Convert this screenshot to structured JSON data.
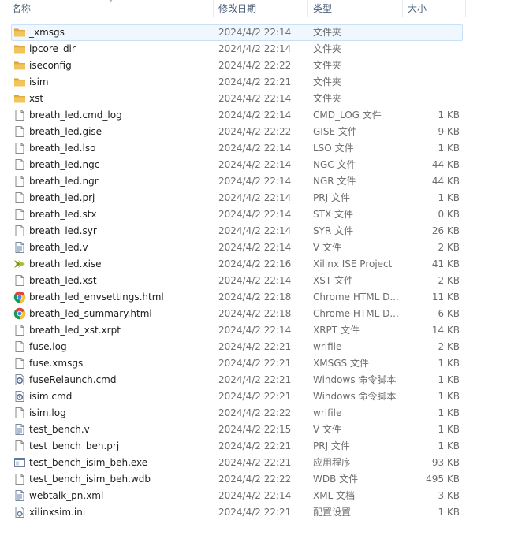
{
  "header": {
    "name": "名称",
    "date": "修改日期",
    "type": "类型",
    "size": "大小"
  },
  "files": [
    {
      "name": "_xmsgs",
      "date": "2024/4/2 22:14",
      "type": "文件夹",
      "size": "",
      "icon": "folder-icon",
      "selected": true
    },
    {
      "name": "ipcore_dir",
      "date": "2024/4/2 22:14",
      "type": "文件夹",
      "size": "",
      "icon": "folder-icon"
    },
    {
      "name": "iseconfig",
      "date": "2024/4/2 22:22",
      "type": "文件夹",
      "size": "",
      "icon": "folder-icon"
    },
    {
      "name": "isim",
      "date": "2024/4/2 22:21",
      "type": "文件夹",
      "size": "",
      "icon": "folder-icon"
    },
    {
      "name": "xst",
      "date": "2024/4/2 22:14",
      "type": "文件夹",
      "size": "",
      "icon": "folder-icon"
    },
    {
      "name": "breath_led.cmd_log",
      "date": "2024/4/2 22:14",
      "type": "CMD_LOG 文件",
      "size": "1 KB",
      "icon": "file-icon"
    },
    {
      "name": "breath_led.gise",
      "date": "2024/4/2 22:22",
      "type": "GISE 文件",
      "size": "9 KB",
      "icon": "file-icon"
    },
    {
      "name": "breath_led.lso",
      "date": "2024/4/2 22:14",
      "type": "LSO 文件",
      "size": "1 KB",
      "icon": "file-icon"
    },
    {
      "name": "breath_led.ngc",
      "date": "2024/4/2 22:14",
      "type": "NGC 文件",
      "size": "44 KB",
      "icon": "file-icon"
    },
    {
      "name": "breath_led.ngr",
      "date": "2024/4/2 22:14",
      "type": "NGR 文件",
      "size": "44 KB",
      "icon": "file-icon"
    },
    {
      "name": "breath_led.prj",
      "date": "2024/4/2 22:14",
      "type": "PRJ 文件",
      "size": "1 KB",
      "icon": "file-icon"
    },
    {
      "name": "breath_led.stx",
      "date": "2024/4/2 22:14",
      "type": "STX 文件",
      "size": "0 KB",
      "icon": "file-icon"
    },
    {
      "name": "breath_led.syr",
      "date": "2024/4/2 22:14",
      "type": "SYR 文件",
      "size": "26 KB",
      "icon": "file-icon"
    },
    {
      "name": "breath_led.v",
      "date": "2024/4/2 22:14",
      "type": "V 文件",
      "size": "2 KB",
      "icon": "text-file-icon"
    },
    {
      "name": "breath_led.xise",
      "date": "2024/4/2 22:16",
      "type": "Xilinx ISE Project",
      "size": "41 KB",
      "icon": "xilinx-icon"
    },
    {
      "name": "breath_led.xst",
      "date": "2024/4/2 22:14",
      "type": "XST 文件",
      "size": "2 KB",
      "icon": "file-icon"
    },
    {
      "name": "breath_led_envsettings.html",
      "date": "2024/4/2 22:18",
      "type": "Chrome HTML D...",
      "size": "11 KB",
      "icon": "chrome-icon"
    },
    {
      "name": "breath_led_summary.html",
      "date": "2024/4/2 22:18",
      "type": "Chrome HTML D...",
      "size": "6 KB",
      "icon": "chrome-icon"
    },
    {
      "name": "breath_led_xst.xrpt",
      "date": "2024/4/2 22:14",
      "type": "XRPT 文件",
      "size": "14 KB",
      "icon": "file-icon"
    },
    {
      "name": "fuse.log",
      "date": "2024/4/2 22:21",
      "type": "wrifile",
      "size": "2 KB",
      "icon": "file-icon"
    },
    {
      "name": "fuse.xmsgs",
      "date": "2024/4/2 22:21",
      "type": "XMSGS 文件",
      "size": "1 KB",
      "icon": "file-icon"
    },
    {
      "name": "fuseRelaunch.cmd",
      "date": "2024/4/2 22:21",
      "type": "Windows 命令脚本",
      "size": "1 KB",
      "icon": "cmd-script-icon"
    },
    {
      "name": "isim.cmd",
      "date": "2024/4/2 22:21",
      "type": "Windows 命令脚本",
      "size": "1 KB",
      "icon": "cmd-script-icon"
    },
    {
      "name": "isim.log",
      "date": "2024/4/2 22:22",
      "type": "wrifile",
      "size": "1 KB",
      "icon": "file-icon"
    },
    {
      "name": "test_bench.v",
      "date": "2024/4/2 22:15",
      "type": "V 文件",
      "size": "1 KB",
      "icon": "text-file-icon"
    },
    {
      "name": "test_bench_beh.prj",
      "date": "2024/4/2 22:21",
      "type": "PRJ 文件",
      "size": "1 KB",
      "icon": "file-icon"
    },
    {
      "name": "test_bench_isim_beh.exe",
      "date": "2024/4/2 22:21",
      "type": "应用程序",
      "size": "93 KB",
      "icon": "exe-icon"
    },
    {
      "name": "test_bench_isim_beh.wdb",
      "date": "2024/4/2 22:22",
      "type": "WDB 文件",
      "size": "495 KB",
      "icon": "file-icon"
    },
    {
      "name": "webtalk_pn.xml",
      "date": "2024/4/2 22:14",
      "type": "XML 文档",
      "size": "3 KB",
      "icon": "text-file-icon"
    },
    {
      "name": "xilinxsim.ini",
      "date": "2024/4/2 22:21",
      "type": "配置设置",
      "size": "1 KB",
      "icon": "ini-icon"
    }
  ],
  "colors": {
    "header_text": "#4c607a",
    "selection_bg": "#f0f7fe",
    "selection_border": "#c9e0f7",
    "folder": "#e9b94a",
    "secondary_text": "#6d6d6d"
  }
}
